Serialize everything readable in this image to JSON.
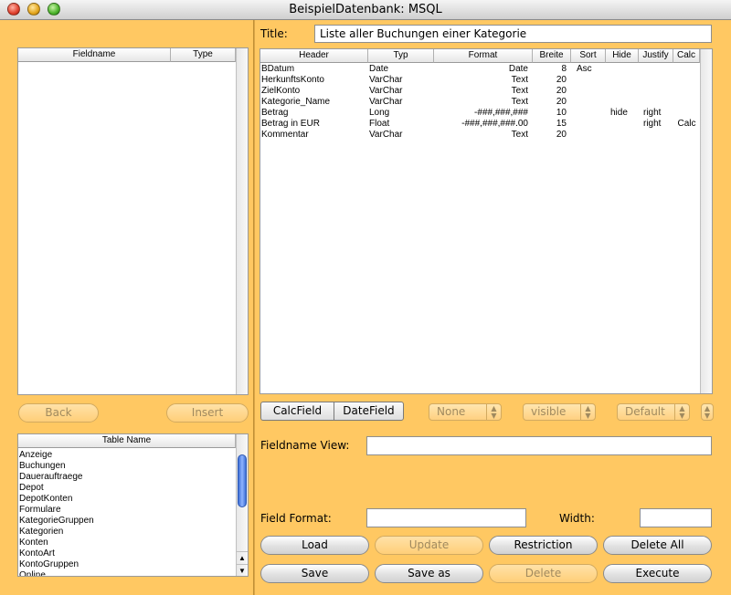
{
  "window": {
    "title": "BeispielDatenbank: MSQL"
  },
  "left": {
    "fields_table": {
      "col_fieldname": "Fieldname",
      "col_type": "Type"
    },
    "back_label": "Back",
    "insert_label": "Insert",
    "tables_table": {
      "header": "Table Name",
      "items": [
        "Anzeige",
        "Buchungen",
        "Dauerauftraege",
        "Depot",
        "DepotKonten",
        "Formulare",
        "KategorieGruppen",
        "Kategorien",
        "Konten",
        "KontoArt",
        "KontoGruppen",
        "Online"
      ]
    }
  },
  "right": {
    "title_label": "Title:",
    "title_value": "Liste aller Buchungen einer Kategorie",
    "grid": {
      "headers": [
        "Header",
        "Typ",
        "Format",
        "Breite",
        "Sort",
        "Hide",
        "Justify",
        "Calc"
      ],
      "rows": [
        [
          "BDatum",
          "Date",
          "Date",
          "8",
          "Asc",
          "",
          "",
          ""
        ],
        [
          "HerkunftsKonto",
          "VarChar",
          "Text",
          "20",
          "",
          "",
          "",
          ""
        ],
        [
          "ZielKonto",
          "VarChar",
          "Text",
          "20",
          "",
          "",
          "",
          ""
        ],
        [
          "Kategorie_Name",
          "VarChar",
          "Text",
          "20",
          "",
          "",
          "",
          ""
        ],
        [
          "Betrag",
          "Long",
          "-###,###,###",
          "10",
          "",
          "hide",
          "right",
          ""
        ],
        [
          "Betrag in EUR",
          "Float",
          "-###,###,###.00",
          "15",
          "",
          "",
          "right",
          "Calc"
        ],
        [
          "Kommentar",
          "VarChar",
          "Text",
          "20",
          "",
          "",
          "",
          ""
        ]
      ]
    },
    "calcfield_label": "CalcField",
    "datefield_label": "DateField",
    "select_sort": "None",
    "select_visible": "visible",
    "select_justify": "Default",
    "fieldname_view_label": "Fieldname View:",
    "fieldname_view_value": "",
    "field_format_label": "Field Format:",
    "field_format_value": "",
    "width_label": "Width:",
    "width_value": "",
    "buttons": {
      "load": "Load",
      "update": "Update",
      "restriction": "Restriction",
      "delete_all": "Delete All",
      "save": "Save",
      "save_as": "Save as",
      "delete": "Delete",
      "execute": "Execute"
    }
  }
}
